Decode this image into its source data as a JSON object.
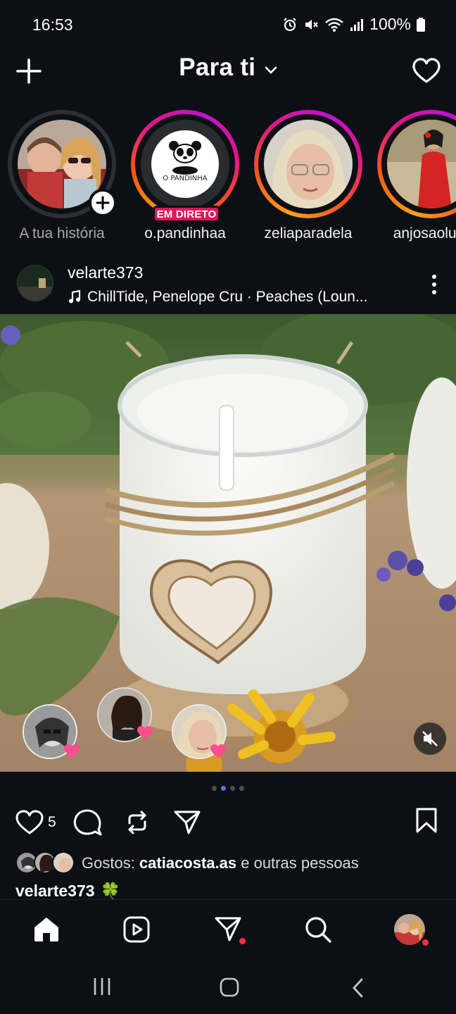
{
  "status_bar": {
    "time": "16:53",
    "battery": "100%",
    "icons": [
      "alarm-icon",
      "mute-icon",
      "wifi-icon",
      "signal-icon",
      "battery-icon"
    ]
  },
  "header": {
    "title": "Para ti",
    "left_icon": "plus-icon",
    "right_icon": "heart-icon"
  },
  "stories": [
    {
      "name": "A tua história",
      "type": "own"
    },
    {
      "name": "o.pandinhaa",
      "type": "live",
      "badge": "EM DIRETO",
      "logo_text": "O PANDINHA"
    },
    {
      "name": "zeliaparadela",
      "type": "story"
    },
    {
      "name": "anjosaoluar",
      "type": "story"
    }
  ],
  "post": {
    "username": "velarte373",
    "music": "ChillTide, Penelope Cru · Peaches (Loun...",
    "carousel_total": 4,
    "carousel_active_index": 1,
    "like_count": "5",
    "likes_prefix": "Gostos: ",
    "likes_user": "catiacosta.as",
    "likes_suffix": " e outras pessoas",
    "caption_user": "velarte373",
    "caption_emoji": "🍀"
  },
  "colors": {
    "background": "#0c0f14",
    "live_badge": "#e3165b",
    "carousel_active": "#4d79ff",
    "notification_dot": "#ff3040"
  },
  "bottom_nav": [
    "home-icon",
    "reels-icon",
    "direct-icon",
    "search-icon",
    "profile-avatar"
  ],
  "system_nav": [
    "recents-button",
    "home-button",
    "back-button"
  ]
}
